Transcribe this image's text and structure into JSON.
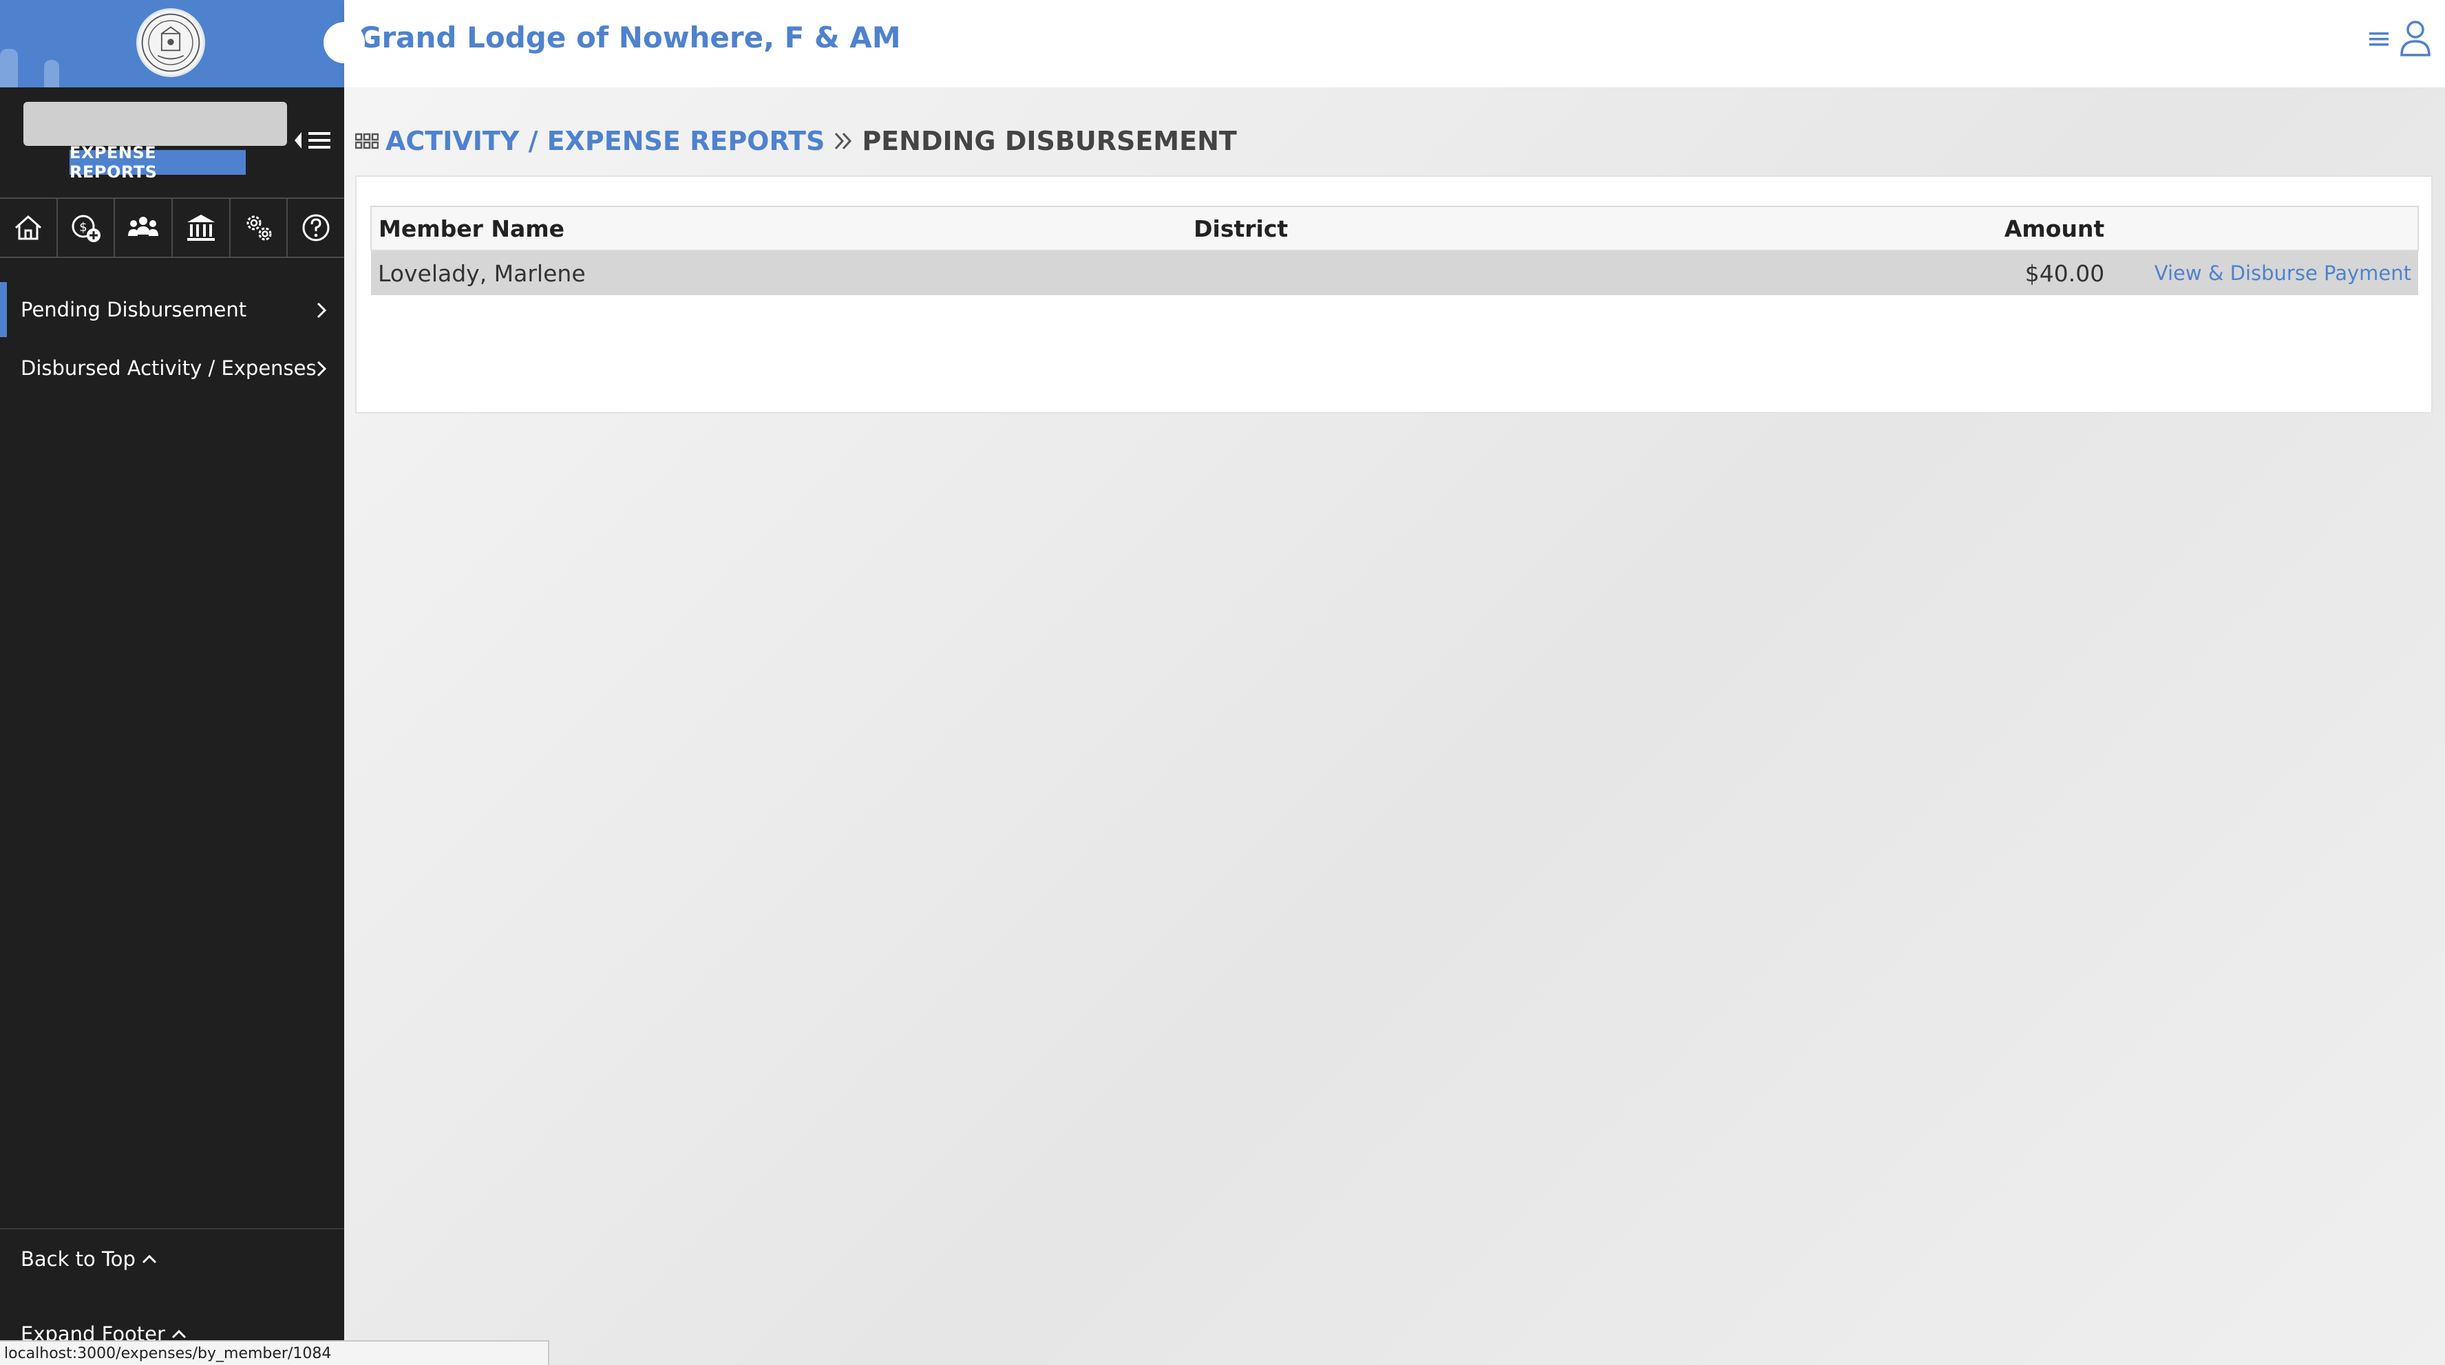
{
  "app": {
    "title": "Grand Lodge of Nowhere, F & AM"
  },
  "sidebar": {
    "module_badge": "EXPENSE REPORTS",
    "search_placeholder": "",
    "icon_row": [
      "home-icon",
      "expense-add-icon",
      "members-icon",
      "lodge-building-icon",
      "settings-gears-icon",
      "help-icon"
    ],
    "nav_items": [
      {
        "label": "Pending Disbursement",
        "active": true
      },
      {
        "label": "Disbursed Activity / Expenses",
        "active": false
      }
    ],
    "back_to_top": "Back to Top",
    "expand_footer": "Expand Footer"
  },
  "breadcrumb": {
    "parent": "ACTIVITY / EXPENSE REPORTS",
    "current": "PENDING DISBURSEMENT"
  },
  "table": {
    "headers": {
      "member_name": "Member Name",
      "district": "District",
      "amount": "Amount"
    },
    "rows": [
      {
        "member_name": "Lovelady, Marlene",
        "district": "",
        "amount": "$40.00",
        "action": "View & Disburse Payment"
      }
    ]
  },
  "status_bar": {
    "url": "localhost:3000/expenses/by_member/1084"
  },
  "colors": {
    "accent": "#4e82cf",
    "sidebar_bg": "#1f1f1f",
    "row_bg": "#d6d6d6"
  }
}
